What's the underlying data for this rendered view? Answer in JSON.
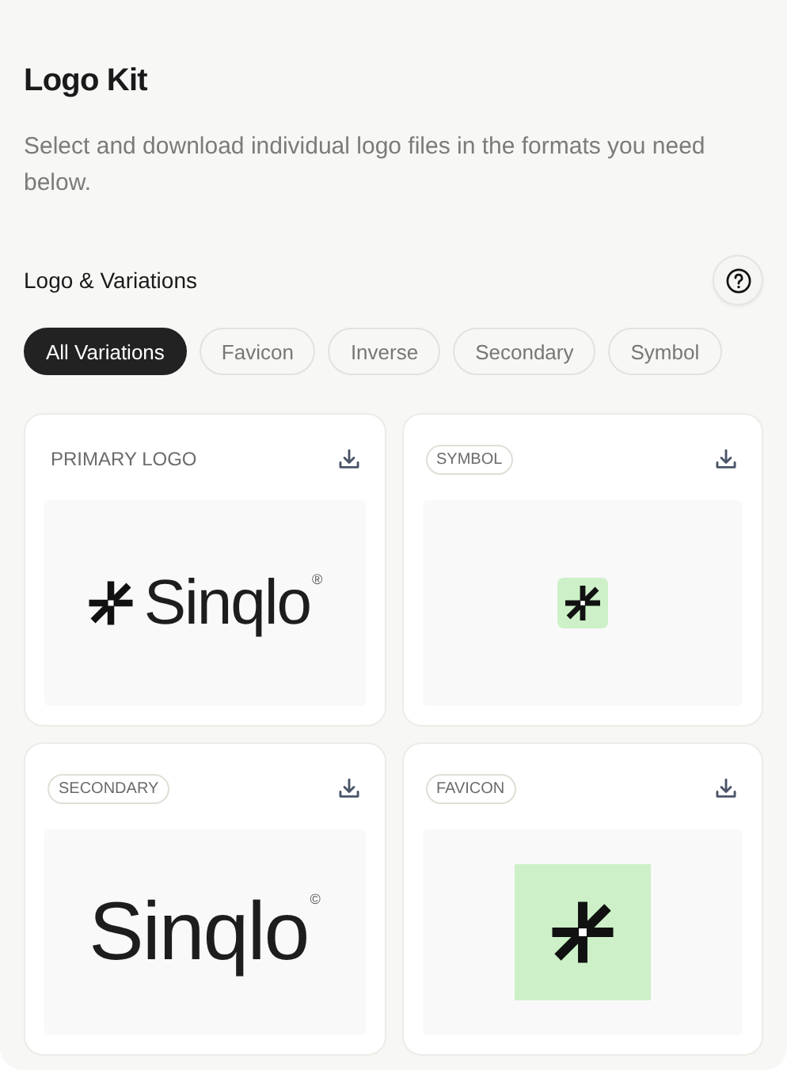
{
  "title": "Logo Kit",
  "description": "Select and download individual logo files in the formats you need below.",
  "section": {
    "title": "Logo & Variations"
  },
  "filters": [
    {
      "label": "All Variations",
      "selected": true
    },
    {
      "label": "Favicon",
      "selected": false
    },
    {
      "label": "Inverse",
      "selected": false
    },
    {
      "label": "Secondary",
      "selected": false
    },
    {
      "label": "Symbol",
      "selected": false
    }
  ],
  "cards": [
    {
      "label": "PRIMARY LOGO",
      "badge": false,
      "kind": "wordmark_with_symbol",
      "wordmark": "Sinqlo",
      "mark": "®"
    },
    {
      "label": "SYMBOL",
      "badge": true,
      "kind": "symbol_small"
    },
    {
      "label": "SECONDARY",
      "badge": true,
      "kind": "wordmark",
      "wordmark": "Sinqlo",
      "mark": "©"
    },
    {
      "label": "FAVICON",
      "badge": true,
      "kind": "favicon"
    }
  ]
}
